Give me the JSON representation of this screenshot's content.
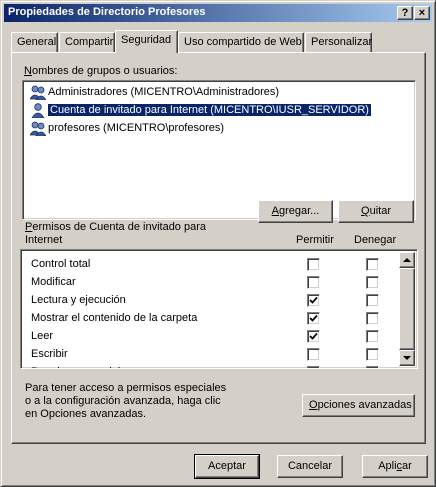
{
  "window": {
    "title": "Propiedades de Directorio Profesores",
    "help_button": "?",
    "close_button": "×"
  },
  "tabs": [
    {
      "label": "General",
      "active": false
    },
    {
      "label": "Compartir",
      "active": false
    },
    {
      "label": "Seguridad",
      "active": true
    },
    {
      "label": "Uso compartido de Web",
      "active": false
    },
    {
      "label": "Personalizar",
      "active": false
    }
  ],
  "users_section": {
    "label_underlined": "N",
    "label_rest": "ombres de grupos o usuarios:",
    "items": [
      {
        "name": "Administradores (MICENTRO\\Administradores)",
        "selected": false
      },
      {
        "name": "Cuenta de invitado para Internet (MICENTRO\\IUSR_SERVIDOR)",
        "selected": true
      },
      {
        "name": "profesores (MICENTRO\\profesores)",
        "selected": false
      }
    ],
    "add_button": {
      "underlined": "A",
      "rest": "gregar..."
    },
    "remove_button": {
      "underlined": "Q",
      "rest": "uitar"
    }
  },
  "permissions": {
    "label_underlined": "P",
    "label_line1_rest": "ermisos de Cuenta de invitado para",
    "label_line2": "Internet",
    "allow_header": "Permitir",
    "deny_header": "Denegar",
    "rows": [
      {
        "name": "Control total",
        "allow": false,
        "deny": false
      },
      {
        "name": "Modificar",
        "allow": false,
        "deny": false
      },
      {
        "name": "Lectura y ejecución",
        "allow": true,
        "deny": false
      },
      {
        "name": "Mostrar el contenido de la carpeta",
        "allow": true,
        "deny": false
      },
      {
        "name": "Leer",
        "allow": true,
        "deny": false
      },
      {
        "name": "Escribir",
        "allow": false,
        "deny": false
      },
      {
        "name": "Permisos especiales",
        "allow": false,
        "deny": false
      }
    ]
  },
  "advanced": {
    "text_line1": "Para tener acceso a permisos especiales",
    "text_line2": "o a la configuración avanzada, haga clic",
    "text_line3": "en Opciones avanzadas.",
    "button": {
      "underlined": "O",
      "rest": "pciones avanzadas"
    }
  },
  "footer": {
    "ok": "Aceptar",
    "cancel": "Cancelar",
    "apply": {
      "pre": "Apli",
      "underlined": "c",
      "post": "ar"
    }
  }
}
